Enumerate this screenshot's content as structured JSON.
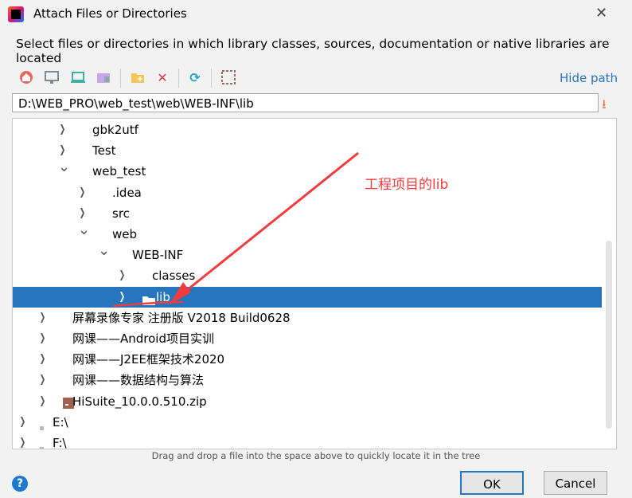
{
  "dialog": {
    "title": "Attach Files or Directories",
    "description": "Select files or directories in which library classes, sources, documentation or native libraries are located"
  },
  "toolbar": {
    "icons": [
      "home-icon",
      "desktop-icon",
      "laptop-icon",
      "modules-icon",
      "new-folder-icon",
      "delete-icon",
      "refresh-icon",
      "select-all-icon"
    ],
    "hide_path": "Hide path"
  },
  "path": {
    "value": "D:\\WEB_PRO\\web_test\\web\\WEB-INF\\lib"
  },
  "tree": [
    {
      "label": "gbk2utf",
      "level": 3,
      "expanded": false
    },
    {
      "label": "Test",
      "level": 3,
      "expanded": false
    },
    {
      "label": "web_test",
      "level": 3,
      "expanded": true
    },
    {
      "label": ".idea",
      "level": 4,
      "expanded": false
    },
    {
      "label": "src",
      "level": 4,
      "expanded": false
    },
    {
      "label": "web",
      "level": 4,
      "expanded": true
    },
    {
      "label": "WEB-INF",
      "level": 5,
      "expanded": true
    },
    {
      "label": "classes",
      "level": 6,
      "expanded": false
    },
    {
      "label": "lib",
      "level": 6,
      "expanded": false,
      "selected": true,
      "icon": "folder-icon"
    },
    {
      "label": "屏幕录像专家 注册版 V2018 Build0628",
      "level": 2,
      "expanded": false
    },
    {
      "label": "网课——Android项目实训",
      "level": 2,
      "expanded": false
    },
    {
      "label": "网课——J2EE框架技术2020",
      "level": 2,
      "expanded": false
    },
    {
      "label": "网课——数据结构与算法",
      "level": 2,
      "expanded": false
    },
    {
      "label": "HiSuite_10.0.0.510.zip",
      "level": 2,
      "expanded": false,
      "icon": "archive-icon"
    },
    {
      "label": "E:\\",
      "level": 1,
      "expanded": false,
      "icon": "drive-icon"
    },
    {
      "label": "F:\\",
      "level": 1,
      "expanded": false,
      "icon": "drive-icon"
    }
  ],
  "hint": "Drag and drop a file into the space above to quickly locate it in the tree",
  "buttons": {
    "ok": "OK",
    "cancel": "Cancel",
    "help": "?"
  },
  "annotation": {
    "text": "工程项目的lib",
    "color": "#f03c3c"
  },
  "colors": {
    "selection": "#2675bf",
    "accent": "#2675bf"
  }
}
